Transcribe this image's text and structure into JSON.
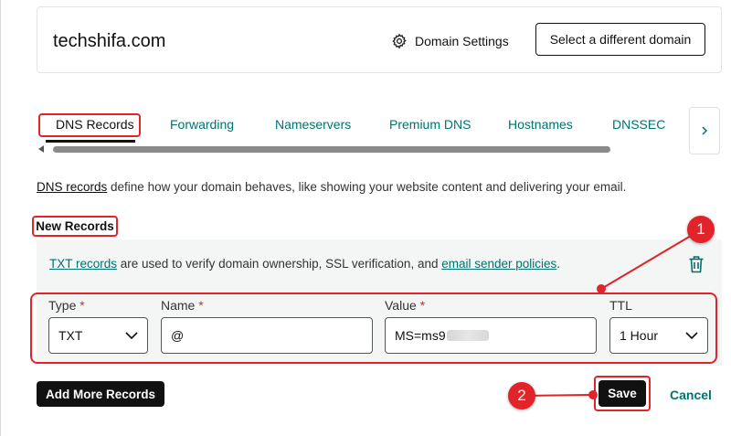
{
  "header": {
    "domain": "techshifa.com",
    "domain_settings_label": "Domain Settings",
    "select_domain_label": "Select a different domain"
  },
  "tabs": [
    {
      "label": "DNS Records",
      "active": true
    },
    {
      "label": "Forwarding",
      "active": false
    },
    {
      "label": "Nameservers",
      "active": false
    },
    {
      "label": "Premium DNS",
      "active": false
    },
    {
      "label": "Hostnames",
      "active": false
    },
    {
      "label": "DNSSEC",
      "active": false
    }
  ],
  "intro": {
    "link": "DNS records",
    "text": " define how your domain behaves, like showing your website content and delivering your email."
  },
  "new_records_label": "New Records",
  "panel": {
    "link1": "TXT records",
    "text": " are used to verify domain ownership, SSL verification, and ",
    "link2": "email sender policies",
    "end": "."
  },
  "form": {
    "type": {
      "label": "Type",
      "required_mark": "*",
      "value": "TXT"
    },
    "name": {
      "label": "Name",
      "required_mark": "*",
      "value": "@"
    },
    "value": {
      "label": "Value",
      "required_mark": "*",
      "value": "MS=ms9"
    },
    "ttl": {
      "label": "TTL",
      "value": "1 Hour"
    }
  },
  "buttons": {
    "add_more": "Add More Records",
    "save": "Save",
    "cancel": "Cancel"
  },
  "annotations": {
    "step1": "1",
    "step2": "2"
  },
  "colors": {
    "accent_teal": "#00736f",
    "highlight_red": "#e0242a",
    "button_black": "#111111",
    "panel_bg": "#f4f5f5"
  }
}
